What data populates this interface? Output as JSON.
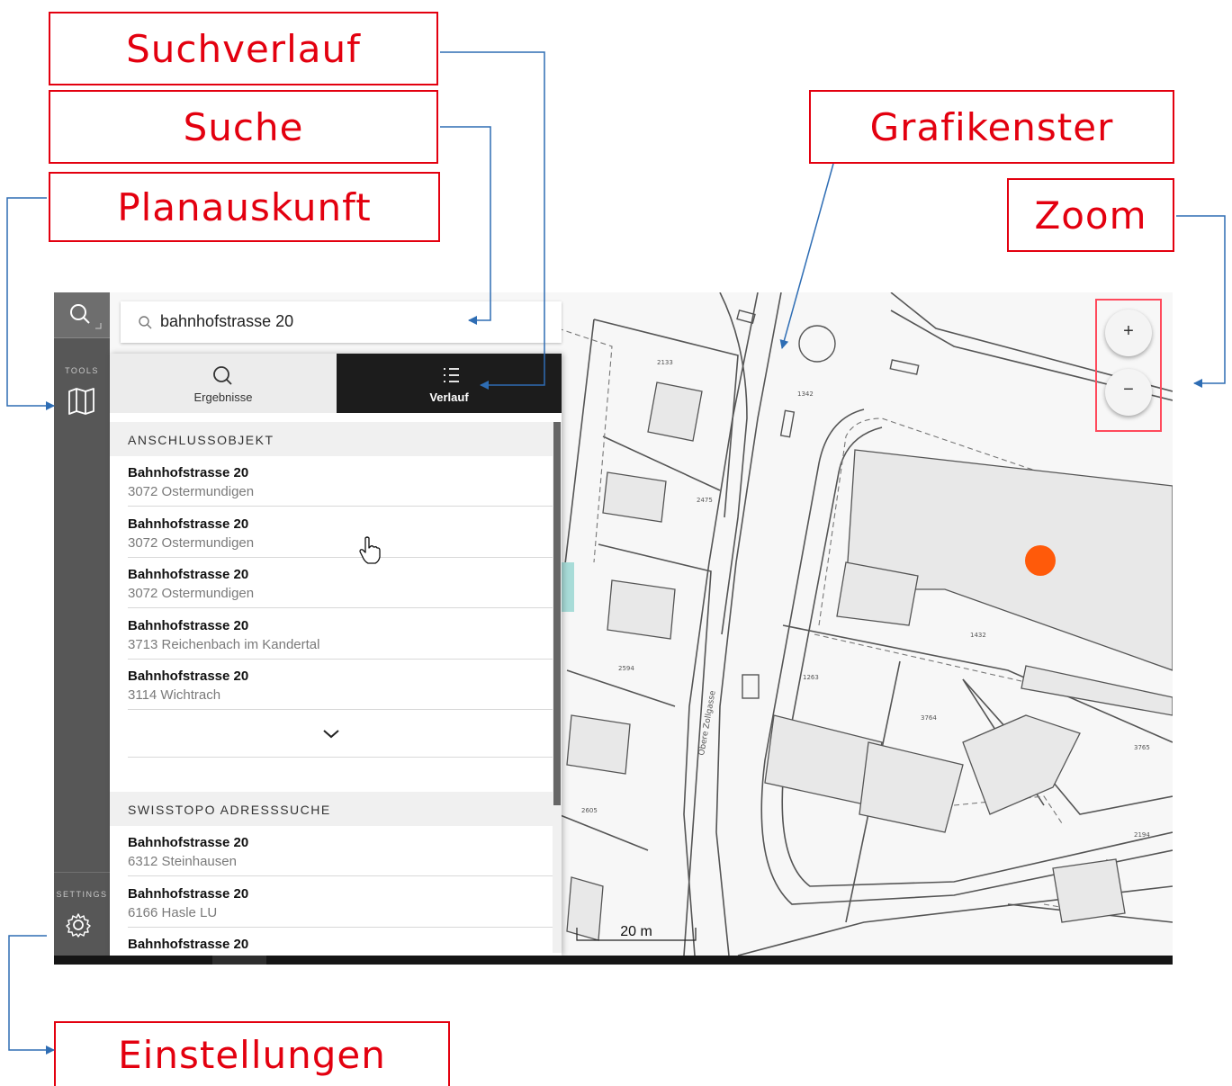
{
  "annotations": {
    "suchverlauf": "Suchverlauf",
    "suche": "Suche",
    "planauskunft": "Planauskunft",
    "grafikenster": "Grafikenster",
    "zoom": "Zoom",
    "einstellungen": "Einstellungen"
  },
  "sidebar": {
    "tools_label": "TOOLS",
    "settings_label": "SETTINGS",
    "icons": [
      "search-icon",
      "map-icon",
      "gear-icon"
    ]
  },
  "search": {
    "value": "bahnhofstrasse 20"
  },
  "tabs": {
    "results": "Ergebnisse",
    "history": "Verlauf"
  },
  "sections": [
    {
      "title": "ANSCHLUSSOBJEKT",
      "items": [
        {
          "street": "Bahnhofstrasse 20",
          "place": "3072 Ostermundigen"
        },
        {
          "street": "Bahnhofstrasse 20",
          "place": "3072 Ostermundigen"
        },
        {
          "street": "Bahnhofstrasse 20",
          "place": "3072 Ostermundigen"
        },
        {
          "street": "Bahnhofstrasse 20",
          "place": "3713 Reichenbach im Kandertal"
        },
        {
          "street": "Bahnhofstrasse 20",
          "place": "3114 Wichtrach"
        }
      ]
    },
    {
      "title": "SWISSTOPO ADRESSSUCHE",
      "items": [
        {
          "street": "Bahnhofstrasse 20",
          "place": "6312 Steinhausen"
        },
        {
          "street": "Bahnhofstrasse 20",
          "place": "6166 Hasle LU"
        },
        {
          "street": "Bahnhofstrasse 20",
          "place": ""
        }
      ]
    }
  ],
  "map": {
    "scale_label": "20 m",
    "street_label": "Obere Zollgasse",
    "parcel_numbers": [
      "2133",
      "1342",
      "2475",
      "2594",
      "1263",
      "1432",
      "3764",
      "3765",
      "2605",
      "2194"
    ],
    "marker_color": "#ff5a0a"
  },
  "zoom": {
    "in_label": "+",
    "out_label": "−"
  },
  "colors": {
    "annotation_red": "#e3000f",
    "arrow_blue": "#2e6db4",
    "sidebar": "#575757",
    "tab_active": "#1c1c1c"
  }
}
